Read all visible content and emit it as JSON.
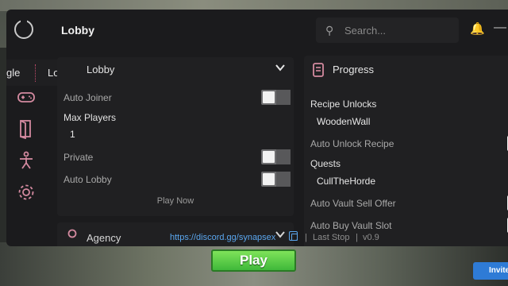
{
  "window": {
    "title": "Lobby"
  },
  "search": {
    "placeholder": "Search..."
  },
  "floatbar": {
    "left_label": "gle",
    "right_label": "Lock"
  },
  "sidebar": {
    "items": [
      {
        "icon": "gamepad-icon"
      },
      {
        "icon": "door-icon"
      },
      {
        "icon": "figure-icon"
      },
      {
        "icon": "gear-icon"
      }
    ]
  },
  "lobby_panel": {
    "title": "Lobby",
    "auto_joiner": {
      "label": "Auto Joiner",
      "on": false
    },
    "max_players": {
      "label": "Max Players",
      "value": "1"
    },
    "private": {
      "label": "Private",
      "on": false
    },
    "auto_lobby": {
      "label": "Auto Lobby",
      "on": false
    },
    "play_now_label": "Play Now"
  },
  "agency_panel": {
    "title": "Agency"
  },
  "progress_panel": {
    "title": "Progress",
    "recipe_unlocks_label": "Recipe Unlocks",
    "recipe_unlocks_value": "WoodenWall",
    "auto_unlock_recipe_label": "Auto Unlock Recipe",
    "quests_label": "Quests",
    "quests_value": "CullTheHorde",
    "auto_vault_sell_label": "Auto Vault Sell Offer",
    "auto_buy_vault_label": "Auto Buy Vault Slot"
  },
  "footer": {
    "link": "https://discord.gg/synapsex",
    "separator": "|",
    "place": "Last Stop",
    "version": "v0.9"
  },
  "game": {
    "play_label": "Play",
    "invite_label": "Invite"
  },
  "colors": {
    "accent": "#d48aa0",
    "link": "#5aa6ee",
    "window_bg": "#1b1b1d",
    "panel_bg": "#202022"
  }
}
